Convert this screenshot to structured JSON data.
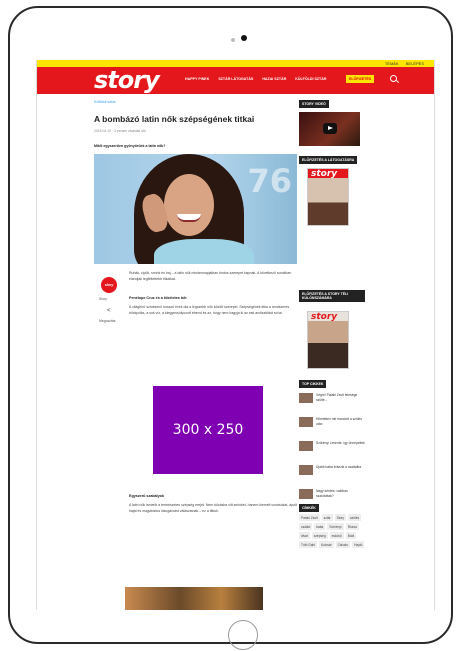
{
  "device": {
    "type": "tablet"
  },
  "topbar": {
    "newsletter": "TÉMÁK",
    "login": "BELÉPÉS"
  },
  "header": {
    "logo": "story",
    "nav": [
      "HAPPY PINEK",
      "SZTÁR LÁTOGATÁS",
      "HAZAI SZTÁR",
      "KÜLFÖLDI SZTÁR"
    ],
    "subscribe": "ELŐFIZETÉS",
    "brand_color": "#e3171c",
    "accent_color": "#ffe600"
  },
  "article": {
    "breadcrumb": "Külföldi sztár",
    "title": "A bombázó latin nők szépségének titkai",
    "meta": "2018.04.10 · 3 perces olvasási idő",
    "lead": "Mitől egyszerűen gyönyörűek a latin nők?",
    "hero_caption": "76",
    "author_badge": "story",
    "author_name": "Story",
    "share_label": "Megosztás",
    "paragraph_1": "Ruhák, cipők, smink és haj – a latin nők mindennapjaiban fontos szerepet kapnak. A következő sorokban elárulják legféltettebb titkaikat.",
    "subhead_1": "Penélope Cruz és a tökéletes bőr",
    "paragraph_2": "A világhírű színésznő hosszú évek óta a legszebb nők között szerepel. Szépségének titka a rendszeres bőrápolás, a sok víz, a kiegyensúlyozott étrend és az, hogy nem hagyja ki az esti arctisztítást soha.",
    "subhead_2": "Egyszerű szabályok",
    "paragraph_3": "A latin nők ismerik a természetes szépség erejét. Nem túlzásba vitt sminket, hanem kiemelt vonásokat, ápolt hajat és magabiztos kisugárzást választanak – ez a titkuk."
  },
  "ad": {
    "label": "300 x 250",
    "color": "#7f00b2"
  },
  "sidebar": {
    "video_heading": "STORY VIDEÓ",
    "magazine_heading": "ELŐFIZETÉS A LÁTOGATÁSRA",
    "magazine2_heading": "ELŐFIZETÉS A STORY TÉLI KÜLÖNSZÁMÁRA",
    "magazine_logo": "story",
    "top_heading": "TOP CIKKEK",
    "top_items": [
      "Végre! Pataki Zsolt felesége szülte...",
      "Hihetetlen mit mondott a szülés után",
      "Szörényi Levente: így ünnepeltek",
      "Újabb baba érkezik a családba",
      "Nagy kérdés: valóban szakítottak?"
    ],
    "tags_heading": "CÍMKÉK",
    "tags": [
      "Pataki Zsolt",
      "sztár",
      "Story",
      "szülés",
      "család",
      "baba",
      "Szörényi",
      "Rúzsa",
      "divat",
      "szépség",
      "esküvő",
      "Bódi",
      "Tóth Gabi",
      "Kulcsár",
      "Csisztu",
      "Hajdú"
    ]
  }
}
